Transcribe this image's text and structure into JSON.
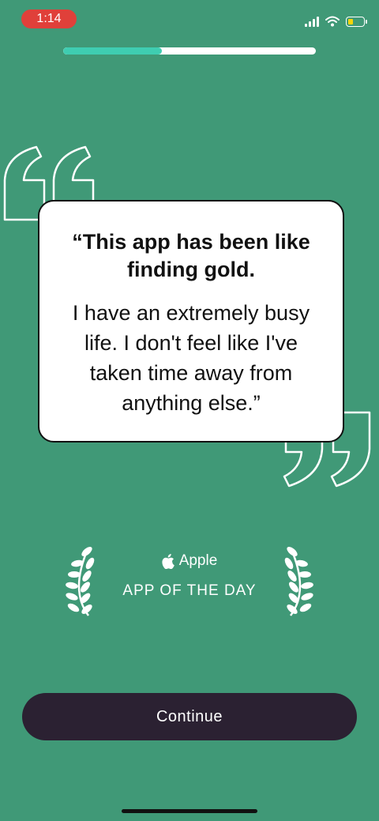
{
  "status_bar": {
    "time": "1:14",
    "battery_level": 0.35
  },
  "progress": {
    "fraction": 0.39
  },
  "testimonial": {
    "headline": "“This app has been like finding gold.",
    "body": "I have an extremely busy life. I don't feel like I've taken time away from anything else.”"
  },
  "award": {
    "brand": "Apple",
    "title": "APP OF THE DAY"
  },
  "continue_button": {
    "label": "Continue"
  },
  "colors": {
    "background": "#409977",
    "progress_fill": "#3fcdb1",
    "button": "#2b2132",
    "status_time_pill": "#e0403a"
  }
}
